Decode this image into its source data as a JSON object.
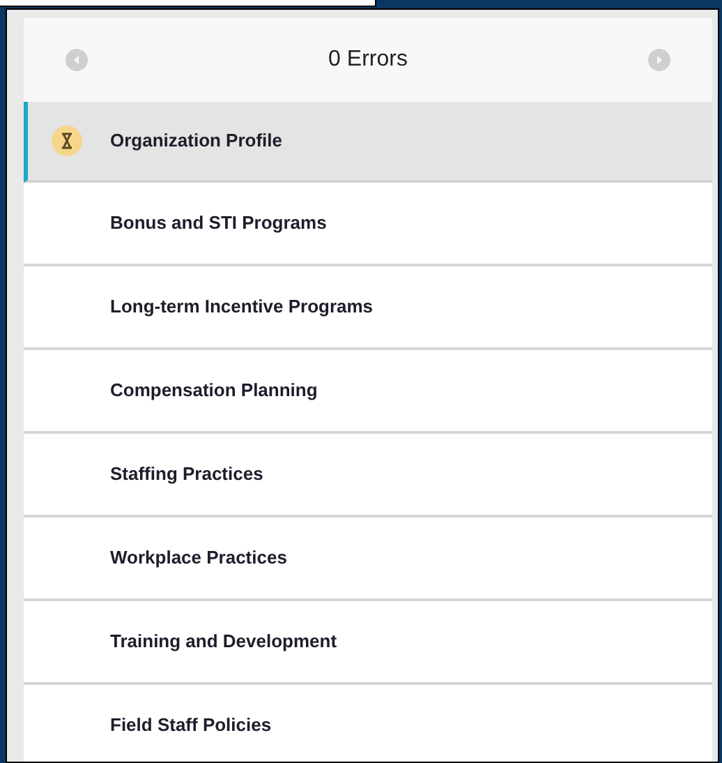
{
  "header": {
    "title": "0 Errors"
  },
  "sections": [
    {
      "label": "Organization Profile",
      "selected": true,
      "pending": true
    },
    {
      "label": "Bonus and STI Programs",
      "selected": false,
      "pending": false
    },
    {
      "label": "Long-term Incentive Programs",
      "selected": false,
      "pending": false
    },
    {
      "label": "Compensation Planning",
      "selected": false,
      "pending": false
    },
    {
      "label": "Staffing Practices",
      "selected": false,
      "pending": false
    },
    {
      "label": "Workplace Practices",
      "selected": false,
      "pending": false
    },
    {
      "label": "Training and Development",
      "selected": false,
      "pending": false
    },
    {
      "label": "Field Staff Policies",
      "selected": false,
      "pending": false
    }
  ]
}
